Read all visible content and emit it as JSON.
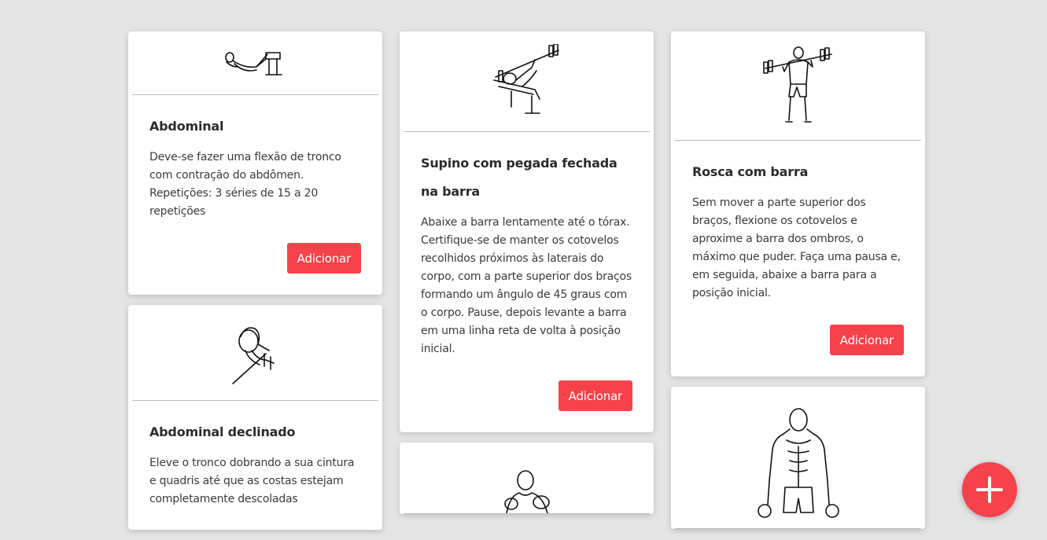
{
  "exercises": [
    {
      "title": "Abdominal",
      "description": "Deve-se fazer uma flexão de tronco com contração do abdômen. Repetições: 3 séries de 15 a 20 repetições",
      "button": "Adicionar",
      "icon": "crunch-illustration"
    },
    {
      "title": "Abdominal declinado",
      "description": "Eleve o tronco dobrando a sua cintura e quadris até que as costas estejam completamente descoladas",
      "button": "Adicionar",
      "icon": "decline-crunch-illustration"
    },
    {
      "title": "Supino com pegada fechada na barra",
      "description": "Abaixe a barra lentamente até o tórax. Certifique-se de manter os cotovelos recolhidos próximos às laterais do corpo, com a parte superior dos braços formando um ângulo de 45 graus com o corpo. Pause, depois levante a barra em uma linha reta de volta à posição inicial.",
      "button": "Adicionar",
      "icon": "close-grip-bench-press-illustration"
    },
    {
      "title": "Rosca com barra",
      "description": "Sem mover a parte superior dos braços, flexione os cotovelos e aproxime a barra dos ombros, o máximo que puder. Faça uma pausa e, em seguida, abaixe a barra para a posição inicial.",
      "button": "Adicionar",
      "icon": "barbell-curl-illustration"
    }
  ],
  "fab": {
    "icon": "plus-icon",
    "color": "#f6424b"
  },
  "colors": {
    "background": "#e5e5e5",
    "accent": "#f6424b",
    "card": "#ffffff"
  }
}
